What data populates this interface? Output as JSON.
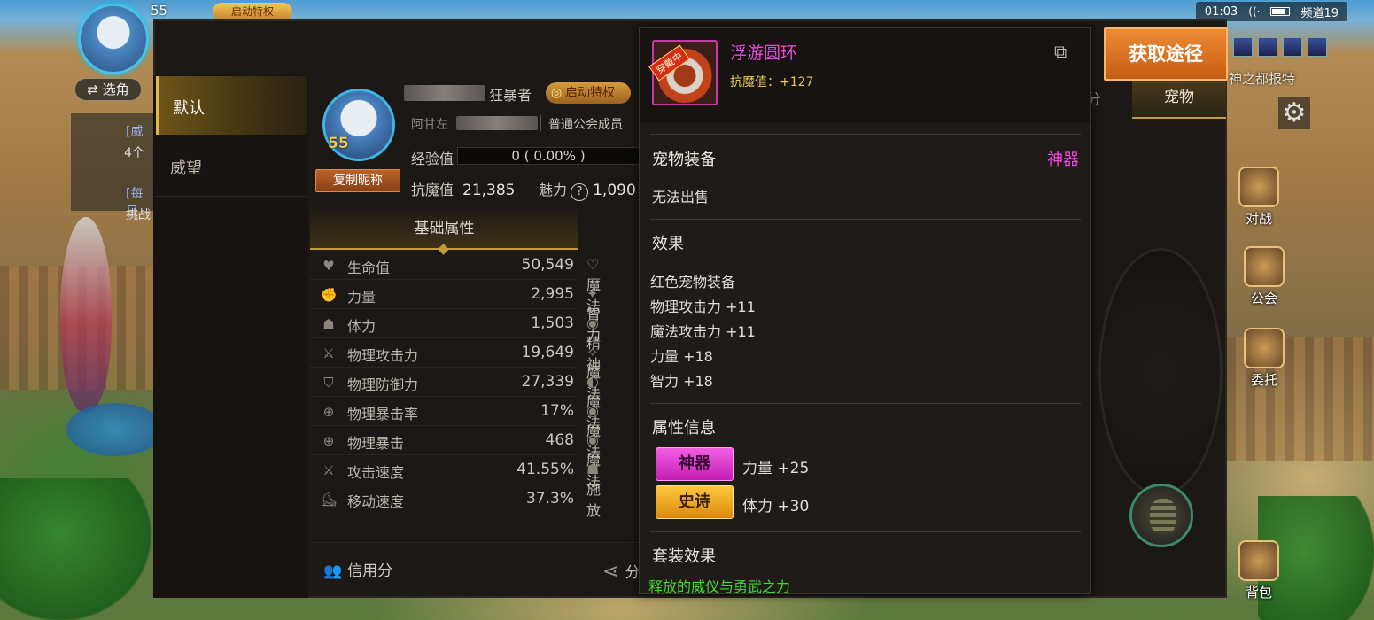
{
  "status_bar": {
    "time": "01:03",
    "channel": "频道19"
  },
  "hud": {
    "level": "55",
    "vip_badge": "启动特权",
    "switch_role": "⇄ 选角",
    "quest_lines": [
      "[威",
      "4个",
      "[每日",
      "挑战"
    ],
    "right_buttons": [
      "对战",
      "公会",
      "委托",
      "背包"
    ],
    "right_top_text": "神之都报特"
  },
  "left_tabs": [
    "默认",
    "威望"
  ],
  "profile": {
    "level": "55",
    "copy_nickname": "复制昵称",
    "class_name": "狂暴者",
    "vip_label": "启动特权",
    "guild_prefix": "阿甘左",
    "guild_role": "普通公会成员",
    "exp_label": "经验值",
    "exp_value": "0 ( 0.00% )",
    "resist_label": "抗魔值",
    "resist_value": "21,385",
    "charm_label": "魅力",
    "charm_value": "1,090"
  },
  "stats": {
    "tab_label": "基础属性",
    "rows": [
      {
        "icon": "heart-icon",
        "name": "生命值",
        "value": "50,549",
        "right": "魔法"
      },
      {
        "icon": "fist-icon",
        "name": "力量",
        "value": "2,995",
        "right": "智力"
      },
      {
        "icon": "body-icon",
        "name": "体力",
        "value": "1,503",
        "right": "精神"
      },
      {
        "icon": "sword-icon",
        "name": "物理攻击力",
        "value": "19,649",
        "right": "魔法"
      },
      {
        "icon": "shield-icon",
        "name": "物理防御力",
        "value": "27,339",
        "right": "魔法"
      },
      {
        "icon": "crosshair-icon",
        "name": "物理暴击率",
        "value": "17%",
        "right": "魔法"
      },
      {
        "icon": "crosshair-icon",
        "name": "物理暴击",
        "value": "468",
        "right": "魔法"
      },
      {
        "icon": "attack-speed-icon",
        "name": "攻击速度",
        "value": "41.55%",
        "right": "施放"
      },
      {
        "icon": "boot-icon",
        "name": "移动速度",
        "value": "37.3%",
        "right": ""
      }
    ],
    "credit_label": "信用分",
    "share_label": "分"
  },
  "right_panel": {
    "tab_fen": "分",
    "tab_pet": "宠物",
    "get_path": "获取途径"
  },
  "tooltip": {
    "item_name": "浮游圆环",
    "item_tag": "穿戴中",
    "item_resist": "抗魔值：+127",
    "section_equipment": "宠物装备",
    "grade": "神器",
    "unsellable": "无法出售",
    "section_effect": "效果",
    "effects": [
      "红色宠物装备",
      "物理攻击力 +11",
      "魔法攻击力 +11",
      "力量 +18",
      "智力 +18"
    ],
    "section_attr": "属性信息",
    "attrs": [
      {
        "label": "神器",
        "value": "力量 +25",
        "color": "#e43ad6"
      },
      {
        "label": "史诗",
        "value": "体力 +30",
        "color": "#f0b020"
      }
    ],
    "section_set": "套装效果",
    "set_name": "释放的威仪与勇武之力"
  },
  "colors": {
    "artifact": "#e94ae0",
    "epic": "#f0b020",
    "set_green": "#3fdb2a",
    "get_path_orange": "#e07a25"
  }
}
